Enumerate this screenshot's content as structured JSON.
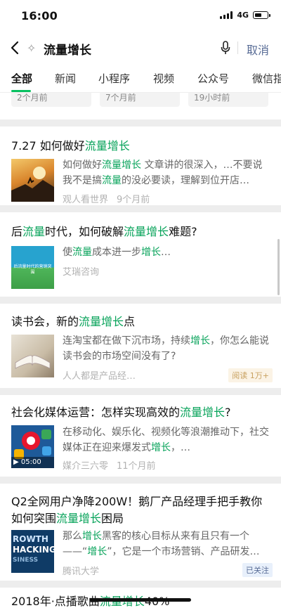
{
  "status_bar": {
    "time": "16:00",
    "network": "4G",
    "battery_level": 0.55
  },
  "search": {
    "query": "流量增长",
    "cancel_label": "取消"
  },
  "tabs": [
    {
      "label": "全部",
      "active": true
    },
    {
      "label": "新闻"
    },
    {
      "label": "小程序"
    },
    {
      "label": "视频"
    },
    {
      "label": "公众号"
    },
    {
      "label": "微信指"
    }
  ],
  "top_stub": {
    "chips": [
      "2个月前",
      "7个月前",
      "19小时前"
    ]
  },
  "results": [
    {
      "title": [
        "7.27 如何做好",
        "流量增长"
      ],
      "desc": [
        "如何做好",
        "流量增长",
        " 文章讲的很深入，…不要说我不是搞",
        "流量",
        "的没必要读，理解到位开店…"
      ],
      "source": "观人看世界",
      "time": "9个月前",
      "thumb": "sunset-climb"
    },
    {
      "title": [
        "后",
        "流量",
        "时代，如何破解",
        "流量增长",
        "难题?"
      ],
      "desc": [
        "使",
        "流量",
        "成本进一步",
        "增长",
        "…"
      ],
      "source": "艾瑞咨询",
      "thumb_text": "后流量时代的营销突围",
      "thumb": "green-banner"
    },
    {
      "title": [
        "读书会，新的",
        "流量增长",
        "点"
      ],
      "desc": [
        "连淘宝都在做下沉市场，持续",
        "增长",
        "，你怎么能说读书会的市场空间没有了?"
      ],
      "source": "人人都是产品经…",
      "tag": "阅读 1万+",
      "thumb": "book"
    },
    {
      "title": [
        "社会化媒体运营：怎样实现高效的",
        "流量增长",
        "?"
      ],
      "desc": [
        "在移动化、娱乐化、视频化等浪潮推动下，社交媒体正在迎来爆发式",
        "增长",
        "，…"
      ],
      "source": "媒介三六零",
      "time": "11个月前",
      "video_duration": "05:00",
      "thumb": "social-icons"
    },
    {
      "title": [
        "Q2全网用户净降200W！鹅厂产品经理手把手教你如何突围",
        "流量增长",
        "困局"
      ],
      "desc": [
        "那么",
        "增长",
        "黑客的核心目标从来有且只有一个——“",
        "增长",
        "”，它是一个市场营销、产品研发…"
      ],
      "source": "腾讯大学",
      "tag": "已关注",
      "thumb_text": [
        "ROWTH",
        "HACKING",
        "SINESS"
      ],
      "thumb": "growth-hacking"
    },
    {
      "title": [
        "2018年·点播歌曲",
        "流量增长",
        "40%"
      ]
    }
  ],
  "colors": {
    "accent": "#07c160",
    "highlight": "#07a35a",
    "link": "#576b95"
  }
}
